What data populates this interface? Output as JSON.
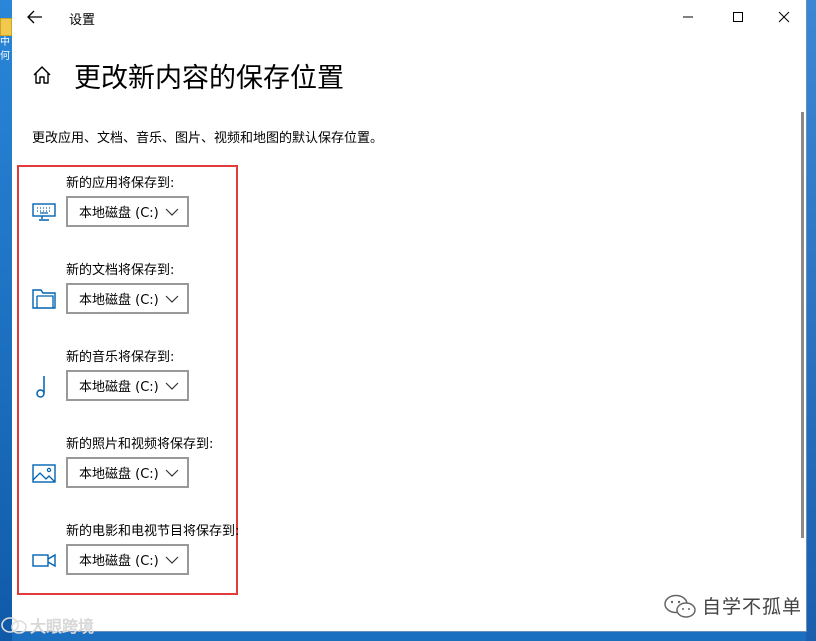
{
  "window": {
    "title": "设置",
    "controls": [
      "minimize",
      "maximize",
      "close"
    ]
  },
  "header": {
    "title": "更改新内容的保存位置",
    "description": "更改应用、文档、音乐、图片、视频和地图的默认保存位置。"
  },
  "settings": [
    {
      "label": "新的应用将保存到:",
      "icon": "monitor-icon",
      "value": "本地磁盘 (C:)"
    },
    {
      "label": "新的文档将保存到:",
      "icon": "folder-icon",
      "value": "本地磁盘 (C:)"
    },
    {
      "label": "新的音乐将保存到:",
      "icon": "music-note-icon",
      "value": "本地磁盘 (C:)"
    },
    {
      "label": "新的照片和视频将保存到:",
      "icon": "picture-icon",
      "value": "本地磁盘 (C:)"
    },
    {
      "label": "新的电影和电视节目将保存到:",
      "icon": "video-camera-icon",
      "value": "本地磁盘 (C:)"
    }
  ],
  "watermark": {
    "text": "自学不孤单",
    "icon": "wechat-icon"
  },
  "taskbar": {
    "text": "大眼跨境"
  },
  "desktop": {
    "icon_text": "中\n何"
  },
  "colors": {
    "accent": "#0063b1",
    "highlight": "#e23b3b"
  }
}
